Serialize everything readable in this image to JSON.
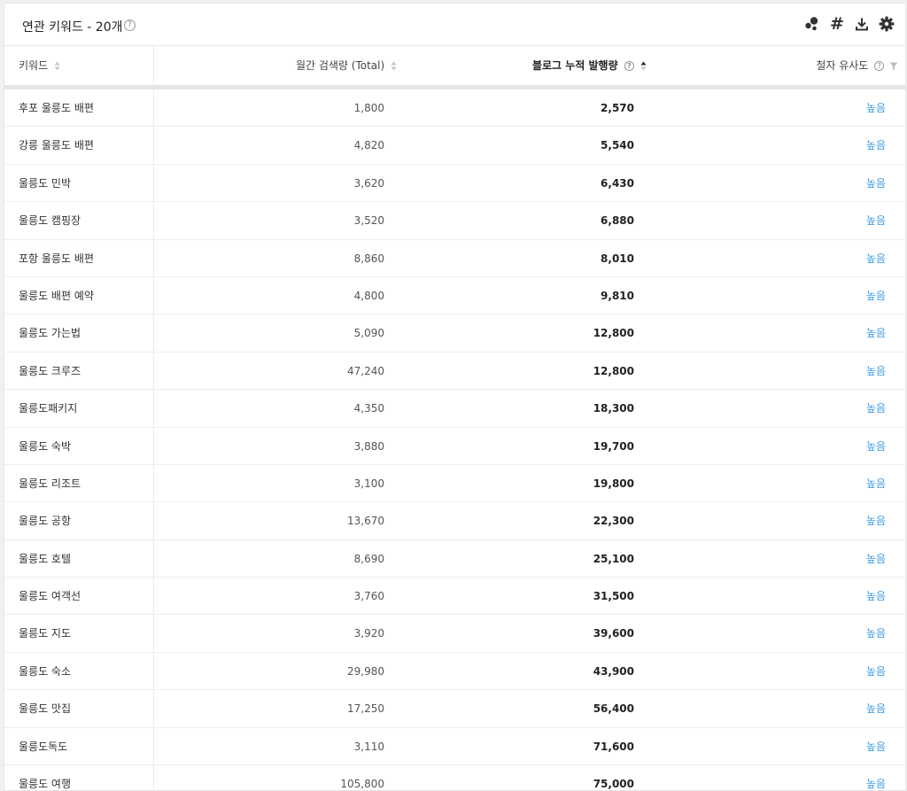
{
  "header": {
    "title": "연관 키워드 - 20개",
    "help_glyph": "?",
    "tools": [
      "bubble-chart-icon",
      "hashtag-icon",
      "download-icon",
      "gear-icon"
    ],
    "hashtag_glyph": "#"
  },
  "columns": {
    "keyword": "키워드",
    "monthly_search": "월간 검색량 (Total)",
    "blog_posts": "블로그 누적 발행량",
    "spelling_similarity": "철자 유사도",
    "help_glyph": "?"
  },
  "rows": [
    {
      "keyword": "후포 울릉도 배편",
      "monthly_search": "1,800",
      "blog_posts": "2,570",
      "similarity": "높음"
    },
    {
      "keyword": "강릉 울릉도 배편",
      "monthly_search": "4,820",
      "blog_posts": "5,540",
      "similarity": "높음"
    },
    {
      "keyword": "울릉도 민박",
      "monthly_search": "3,620",
      "blog_posts": "6,430",
      "similarity": "높음"
    },
    {
      "keyword": "울릉도 캠핑장",
      "monthly_search": "3,520",
      "blog_posts": "6,880",
      "similarity": "높음"
    },
    {
      "keyword": "포항 울릉도 배편",
      "monthly_search": "8,860",
      "blog_posts": "8,010",
      "similarity": "높음"
    },
    {
      "keyword": "울릉도 배편 예약",
      "monthly_search": "4,800",
      "blog_posts": "9,810",
      "similarity": "높음"
    },
    {
      "keyword": "울릉도 가는법",
      "monthly_search": "5,090",
      "blog_posts": "12,800",
      "similarity": "높음"
    },
    {
      "keyword": "울릉도 크루즈",
      "monthly_search": "47,240",
      "blog_posts": "12,800",
      "similarity": "높음"
    },
    {
      "keyword": "울릉도패키지",
      "monthly_search": "4,350",
      "blog_posts": "18,300",
      "similarity": "높음"
    },
    {
      "keyword": "울릉도 숙박",
      "monthly_search": "3,880",
      "blog_posts": "19,700",
      "similarity": "높음"
    },
    {
      "keyword": "울릉도 리조트",
      "monthly_search": "3,100",
      "blog_posts": "19,800",
      "similarity": "높음"
    },
    {
      "keyword": "울릉도 공항",
      "monthly_search": "13,670",
      "blog_posts": "22,300",
      "similarity": "높음"
    },
    {
      "keyword": "울릉도 호텔",
      "monthly_search": "8,690",
      "blog_posts": "25,100",
      "similarity": "높음"
    },
    {
      "keyword": "울릉도 여객선",
      "monthly_search": "3,760",
      "blog_posts": "31,500",
      "similarity": "높음"
    },
    {
      "keyword": "울릉도 지도",
      "monthly_search": "3,920",
      "blog_posts": "39,600",
      "similarity": "높음"
    },
    {
      "keyword": "울릉도 숙소",
      "monthly_search": "29,980",
      "blog_posts": "43,900",
      "similarity": "높음"
    },
    {
      "keyword": "울릉도 맛집",
      "monthly_search": "17,250",
      "blog_posts": "56,400",
      "similarity": "높음"
    },
    {
      "keyword": "울릉도독도",
      "monthly_search": "3,110",
      "blog_posts": "71,600",
      "similarity": "높음"
    },
    {
      "keyword": "울릉도 여행",
      "monthly_search": "105,800",
      "blog_posts": "75,000",
      "similarity": "높음"
    }
  ],
  "colors": {
    "accent_link": "#3a9be0",
    "band": "#e5e5e5",
    "border": "#eeeeee"
  }
}
